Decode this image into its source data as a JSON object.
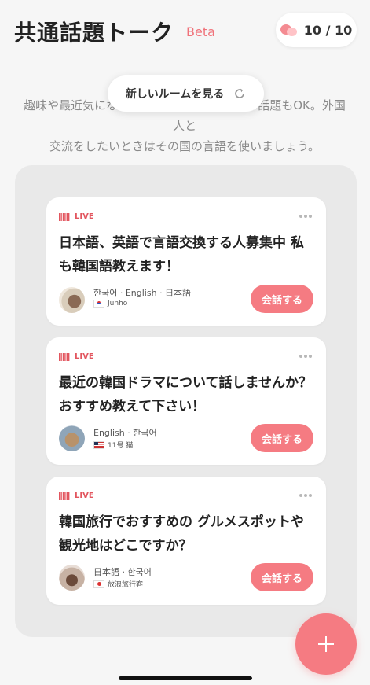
{
  "header": {
    "title": "共通話題トーク",
    "badge": "Beta",
    "counter": "10 / 10"
  },
  "intro": {
    "subtitle_line1": "趣味や最近気になっていることなど、どんな話題もOK。外国人と",
    "subtitle_line2": "交流をしたいときはその国の言語を使いましょう。"
  },
  "toast": {
    "label": "新しいルームを見る",
    "icon": "refresh-icon"
  },
  "rooms": [
    {
      "status": "LIVE",
      "title": "日本語、英語で言語交換する人募集中 私も韓国語教えます！",
      "languages": "한국어 · English · 日本語",
      "user": "Junho",
      "flag": "korea",
      "action": "会話する"
    },
    {
      "status": "LIVE",
      "title": "最近の韓国ドラマについて話しませんか？おすすめ教えて下さい！",
      "languages": "English · 한국어",
      "user": "11号 猫",
      "flag": "usa",
      "action": "会話する"
    },
    {
      "status": "LIVE",
      "title": "韓国旅行でおすすめの グルメスポットや観光地はどこですか？",
      "languages": "日本語 · 한국어",
      "user": "放浪旅行客",
      "flag": "japan",
      "action": "会話する"
    }
  ],
  "fab": {
    "icon": "plus-icon"
  },
  "colors": {
    "accent": "#f57b82",
    "live": "#e2555e",
    "background": "#f6f6f6",
    "panel": "#e9e9e9"
  }
}
